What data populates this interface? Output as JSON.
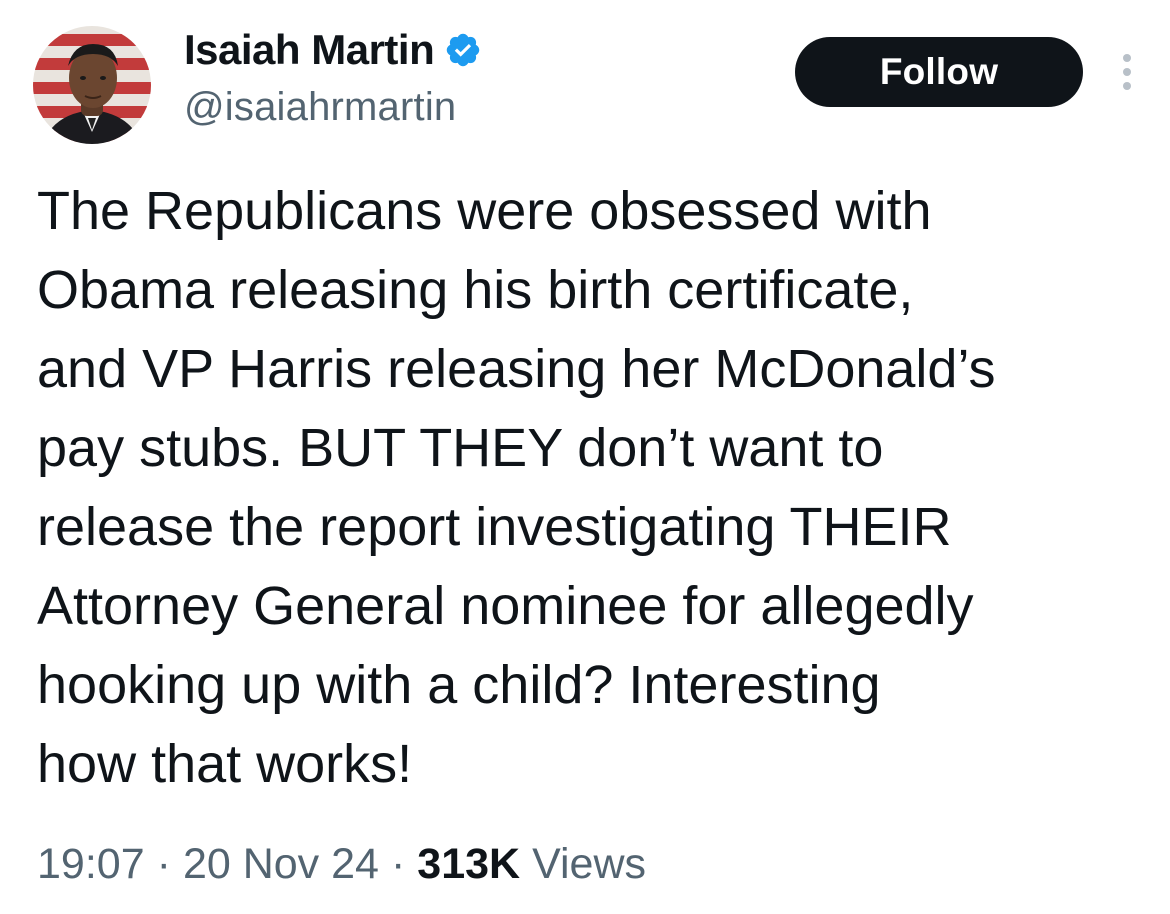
{
  "author": {
    "display_name": "Isaiah Martin",
    "handle": "@isaiahrmartin",
    "verified_icon": "verified-badge-icon",
    "verified_color": "#1d9bf0"
  },
  "actions": {
    "follow_label": "Follow",
    "more_icon": "vertical-ellipsis-icon"
  },
  "tweet": {
    "lines": [
      "The Republicans were obsessed with",
      "Obama releasing his birth certificate,",
      "and VP Harris releasing her McDonald’s",
      "pay stubs. BUT THEY don’t want to",
      "release the report investigating THEIR",
      "Attorney General nominee for allegedly",
      "hooking up with a child? Interesting",
      "how that works!"
    ]
  },
  "meta": {
    "time": "19:07",
    "separator": "·",
    "date": "20 Nov 24",
    "views_count": "313K",
    "views_label": "Views"
  },
  "colors": {
    "text_primary": "#0f1419",
    "text_secondary": "#536471",
    "follow_bg": "#0f1419",
    "follow_text": "#ffffff"
  }
}
